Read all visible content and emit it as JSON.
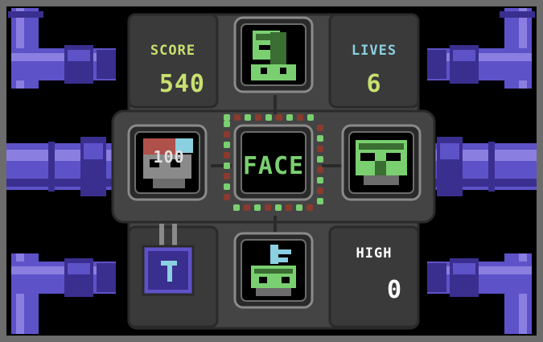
{
  "hud": {
    "score_label": "SCORE",
    "score_value": "540",
    "lives_label": "LIVES",
    "lives_value": "6",
    "high_label": "HIGH",
    "high_value": "0"
  },
  "center": {
    "target_label": "FACE"
  },
  "popup": {
    "points": "100"
  },
  "tiles": [
    {
      "position": "top",
      "content": "face-piece-top"
    },
    {
      "position": "left",
      "content": "face-piece-mixed"
    },
    {
      "position": "right",
      "content": "face-piece-eyes"
    },
    {
      "position": "bottom",
      "content": "face-piece-mouth"
    }
  ],
  "colors": {
    "background": "#000000",
    "border": "#6c6c6c",
    "panel": "#444444",
    "panel_dark": "#2a2a2a",
    "pipe_light": "#8a7fe0",
    "pipe_mid": "#5e52c8",
    "pipe_dark": "#3a2f8f",
    "score_label": "#c8e070",
    "lives_label": "#8ad0e0",
    "high_label": "#ffffff",
    "face_green": "#7ad070",
    "face_dark_green": "#3a6e32",
    "dot_red": "#8b3a2e",
    "dot_green": "#7ad070",
    "popup_text": "#e0e0e0"
  }
}
